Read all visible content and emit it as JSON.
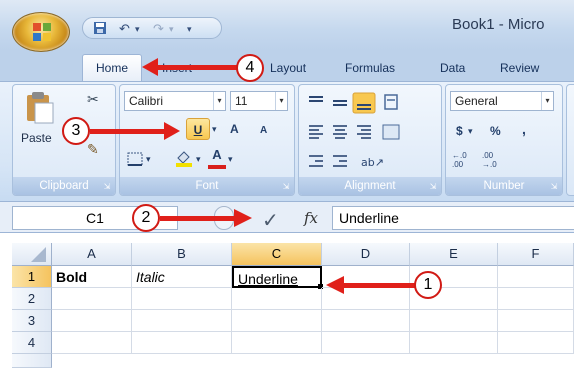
{
  "window": {
    "title": "Book1 - Micro"
  },
  "tabs": [
    {
      "label": "Home"
    },
    {
      "label": "Insert"
    },
    {
      "label": "Layout"
    },
    {
      "label": "Formulas"
    },
    {
      "label": "Data"
    },
    {
      "label": "Review"
    }
  ],
  "ribbon": {
    "clipboard": {
      "label": "Clipboard",
      "paste_label": "Paste"
    },
    "font": {
      "label": "Font",
      "name": "Calibri",
      "size": "11",
      "underline_label": "U",
      "grow_label": "A",
      "shrink_label": "A",
      "color_label": "A"
    },
    "alignment": {
      "label": "Alignment"
    },
    "number": {
      "label": "Number",
      "format": "General",
      "currency": "$",
      "percent": "%",
      "comma": ",",
      "inc_decimal": "+.0 .00",
      "dec_decimal": ".00 →.0"
    }
  },
  "formula_bar": {
    "name_box": "C1",
    "fx_label": "fx",
    "content": "Underline"
  },
  "grid": {
    "columns": [
      "A",
      "B",
      "C",
      "D",
      "E",
      "F"
    ],
    "rows": [
      "1",
      "2",
      "3",
      "4"
    ],
    "cells": {
      "A1": "Bold",
      "B1": "Italic",
      "C1": "Underline"
    }
  },
  "callouts": [
    "1",
    "2",
    "3",
    "4"
  ],
  "colors": {
    "accent_red": "#e0201a",
    "highlight": "#f8c850",
    "ribbon_blue": "#c7dbf2"
  },
  "icons": [
    "office-button-icon",
    "save-icon",
    "undo-icon",
    "redo-icon",
    "cut-icon",
    "format-painter-icon",
    "borders-icon",
    "fill-color-icon",
    "enter-checkmark-icon",
    "function-icon"
  ]
}
